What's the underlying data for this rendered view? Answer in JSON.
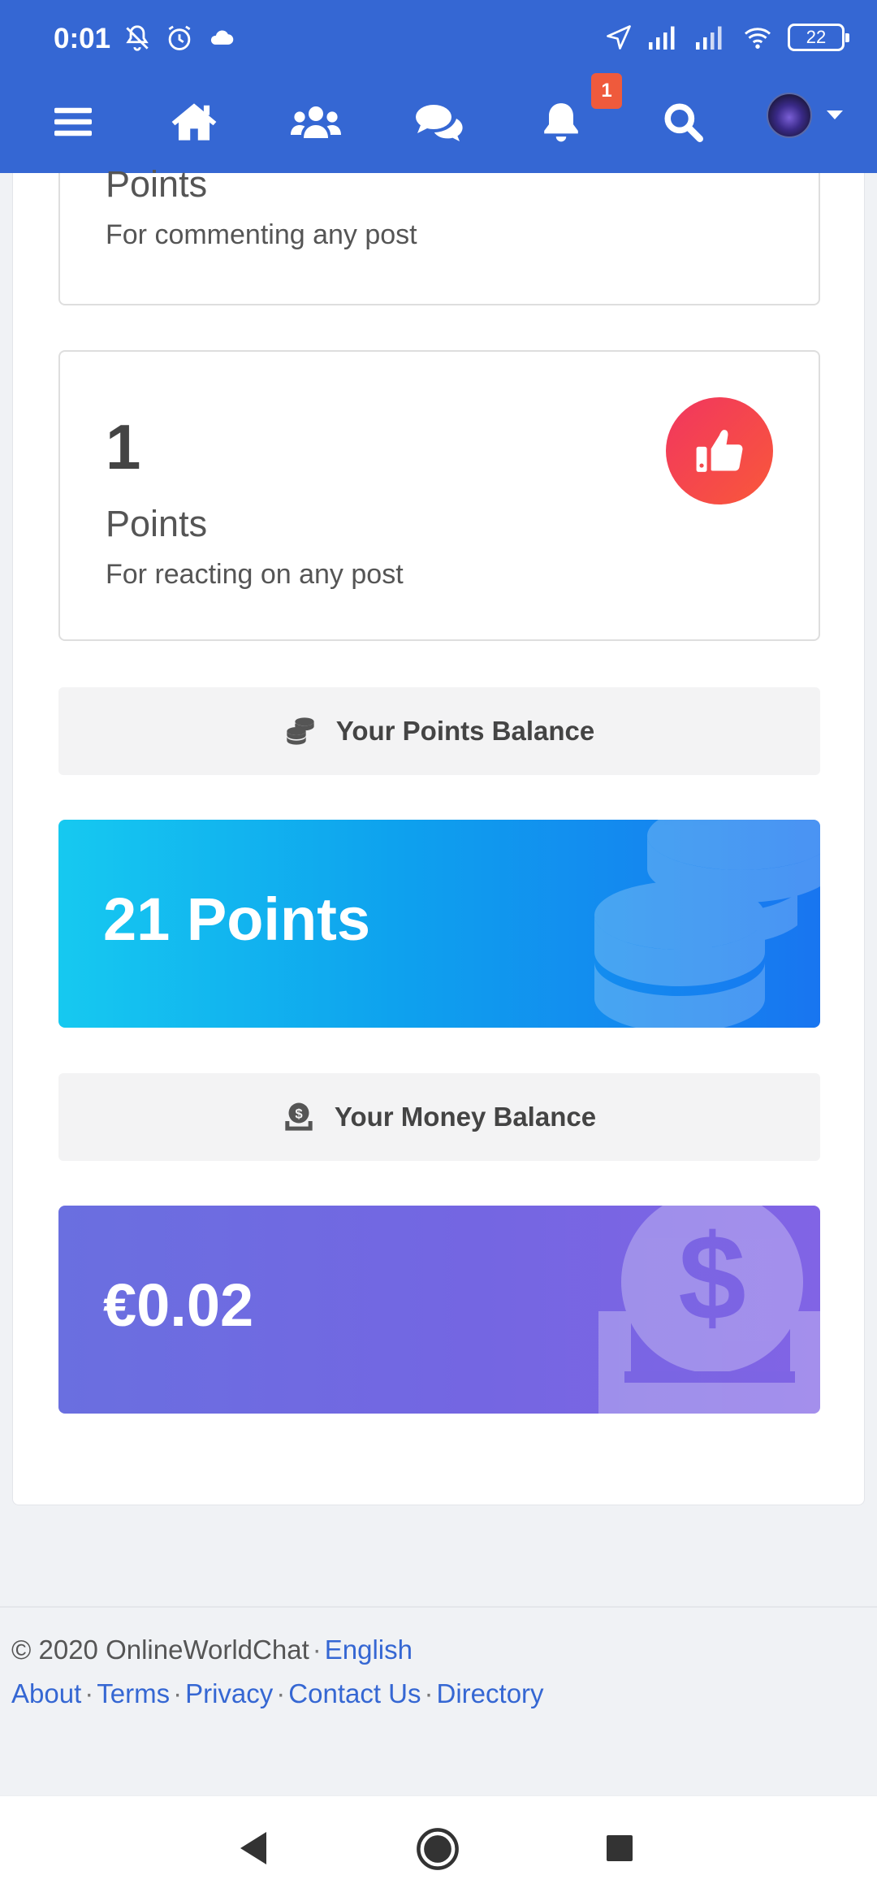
{
  "status_bar": {
    "time": "0:01",
    "battery": "22",
    "icons": [
      "mute-icon",
      "alarm-icon",
      "cloud-icon",
      "location-icon",
      "signal-icon",
      "signal-icon",
      "wifi-icon",
      "battery-icon"
    ]
  },
  "nav": {
    "items": [
      "menu-icon",
      "home-icon",
      "users-icon",
      "chat-icon",
      "bell-icon",
      "search-icon"
    ],
    "notification_count": "1"
  },
  "cards": {
    "comment": {
      "unit": "Points",
      "description": "For commenting any post"
    },
    "react": {
      "number": "1",
      "unit": "Points",
      "description": "For reacting on any post"
    }
  },
  "points_balance": {
    "header": "Your Points Balance",
    "value": "21 Points"
  },
  "money_balance": {
    "header": "Your Money Balance",
    "value": "€0.02"
  },
  "footer": {
    "copyright": "© 2020 OnlineWorldChat",
    "language": "English",
    "links": [
      "About",
      "Terms",
      "Privacy",
      "Contact Us",
      "Directory"
    ]
  },
  "colors": {
    "brand": "#3567d3",
    "react_gradient": [
      "#f1365f",
      "#f9583a"
    ],
    "points_gradient": [
      "#16c9f0",
      "#1875f0"
    ],
    "money_gradient": [
      "#6a6fe0",
      "#8164e5"
    ]
  }
}
